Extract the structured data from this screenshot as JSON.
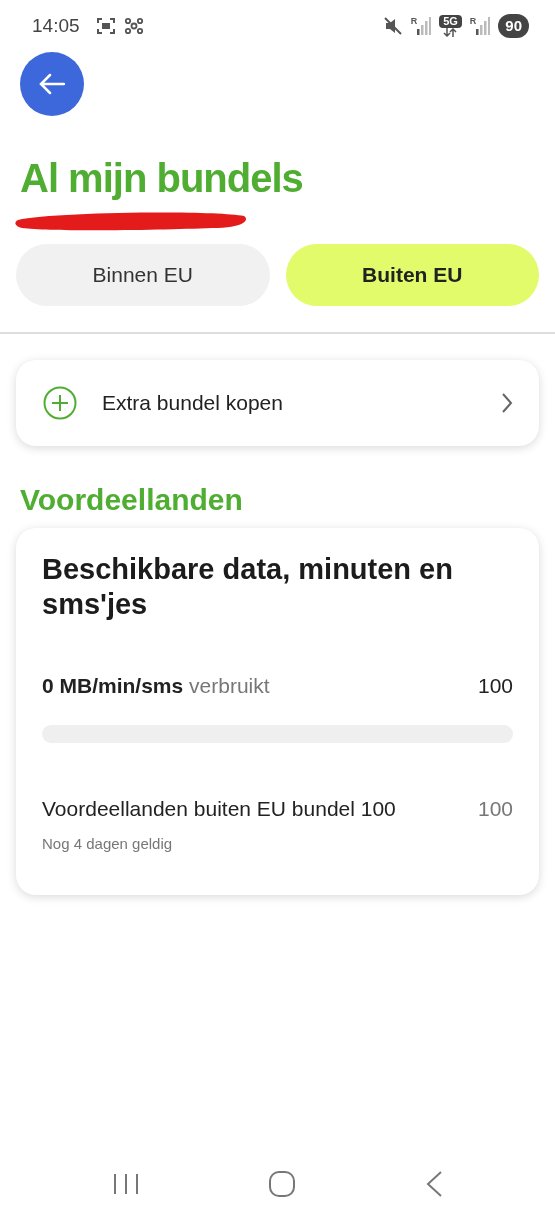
{
  "status_bar": {
    "time": "14:05",
    "sim_labels": [
      "R",
      "R"
    ],
    "network": "5G",
    "battery": "90"
  },
  "header": {
    "title": "Al mijn bundels"
  },
  "tabs": [
    {
      "label": "Binnen EU",
      "selected": false
    },
    {
      "label": "Buiten EU",
      "selected": true
    }
  ],
  "buy_row": {
    "label": "Extra bundel kopen"
  },
  "section": {
    "title": "Voordeellanden"
  },
  "card": {
    "title": "Beschikbare data, minuten en sms'jes",
    "usage": {
      "amount": "0 MB/min/sms",
      "suffix": "verbruikt",
      "total": "100",
      "level": 0
    },
    "bundles": [
      {
        "name": "Voordeellanden buiten EU bundel 100",
        "amount": "100",
        "validity": "Nog 4 dagen geldig"
      }
    ]
  }
}
